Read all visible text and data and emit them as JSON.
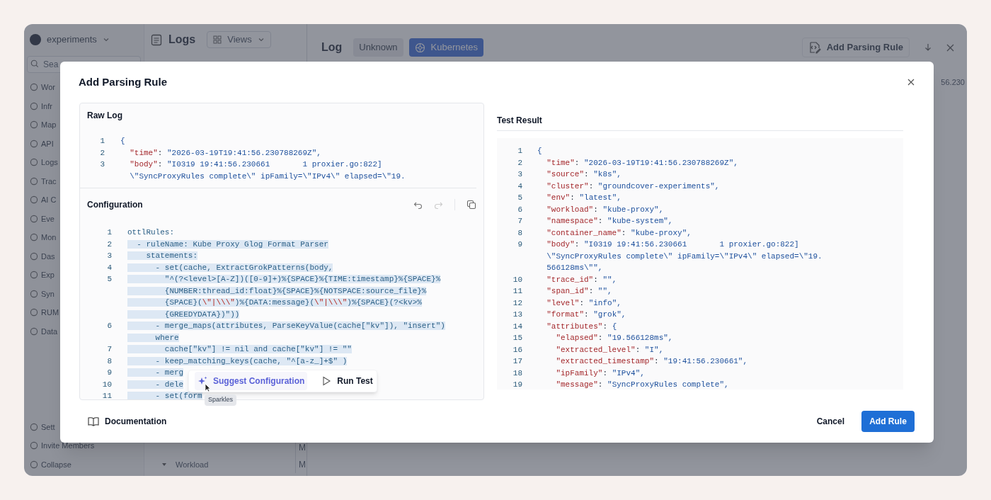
{
  "app": {
    "workspace": "experiments",
    "search_placeholder": "Sea",
    "nav": [
      {
        "label": "Wor"
      },
      {
        "label": "Infr"
      },
      {
        "label": "Map"
      },
      {
        "label": "API"
      },
      {
        "label": "Logs"
      },
      {
        "label": "Trac"
      },
      {
        "label": "AI C"
      },
      {
        "label": "Eve"
      },
      {
        "label": "Mon"
      },
      {
        "label": "Das"
      },
      {
        "label": "Exp"
      },
      {
        "label": "Syn"
      },
      {
        "label": "RUM"
      },
      {
        "label": "Data"
      }
    ],
    "bottom_nav": [
      {
        "label": "Sett"
      },
      {
        "label": "Invite Members"
      },
      {
        "label": "Collapse"
      }
    ],
    "page_title": "Logs",
    "views_button": "Views",
    "tree_item": "Workload",
    "column_cells": [
      "M",
      "M"
    ],
    "log_panel": {
      "title": "Log",
      "tags": [
        {
          "label": "Unknown",
          "selected": false
        },
        {
          "label": "Kubernetes",
          "selected": true
        }
      ],
      "add_rule_button": "Add Parsing Rule",
      "timestamp": "56.230"
    }
  },
  "dialog": {
    "title": "Add Parsing Rule",
    "raw_log": {
      "title": "Raw Log",
      "lines": [
        {
          "number": "1",
          "rows": [
            "{"
          ]
        },
        {
          "number": "2",
          "rows": [
            "  \"time\": \"2026-03-19T19:41:56.230788269Z\","
          ]
        },
        {
          "number": "3",
          "rows": [
            "  \"body\": \"I0319 19:41:56.230661       1 proxier.go:822]",
            "  \\\"SyncProxyRules complete\\\" ipFamily=\\\"IPv4\\\" elapsed=\\\"19."
          ]
        }
      ]
    },
    "configuration": {
      "title": "Configuration",
      "lines": [
        {
          "number": "1",
          "selected": false,
          "rows": [
            "ottlRules:"
          ]
        },
        {
          "number": "2",
          "selected": true,
          "rows": [
            "  - ruleName: Kube Proxy Glog Format Parser"
          ]
        },
        {
          "number": "3",
          "selected": true,
          "rows": [
            "    statements:"
          ]
        },
        {
          "number": "4",
          "selected": true,
          "rows": [
            "      - set(cache, ExtractGrokPatterns(body,"
          ]
        },
        {
          "number": "5",
          "selected": true,
          "rows": [
            "        \"^(?<level>[A-Z])([0-9]+)%{SPACE}%{TIME:timestamp}%{SPACE}%",
            "        {NUMBER:thread_id:float}%{SPACE}%{NOTSPACE:source_file}%",
            "        {SPACE}(\\\"|\\\\\\\")%{DATA:message}(\\\"|\\\\\\\")%{SPACE}(?<kv>%",
            "        {GREEDYDATA})\"))"
          ]
        },
        {
          "number": "6",
          "selected": true,
          "rows": [
            "      - merge_maps(attributes, ParseKeyValue(cache[\"kv\"]), \"insert\")",
            "      where"
          ]
        },
        {
          "number": "7",
          "selected": true,
          "rows": [
            "        cache[\"kv\"] != nil and cache[\"kv\"] != \"\""
          ]
        },
        {
          "number": "8",
          "selected": true,
          "rows": [
            "      - keep_matching_keys(cache, \"^[a-z_]+$\" )"
          ]
        },
        {
          "number": "9",
          "selected": true,
          "rows": [
            "      - merg"
          ]
        },
        {
          "number": "10",
          "selected": true,
          "rows": [
            "      - dele"
          ]
        },
        {
          "number": "11",
          "selected": true,
          "rows": [
            "      - set(form"
          ]
        }
      ],
      "suggest_button": "Suggest Configuration",
      "run_button": "Run Test",
      "tooltip": "Sparkles"
    },
    "test_result": {
      "title": "Test Result",
      "lines": [
        {
          "number": "1",
          "rows": [
            "{"
          ]
        },
        {
          "number": "2",
          "rows": [
            "  \"time\": \"2026-03-19T19:41:56.230788269Z\","
          ]
        },
        {
          "number": "3",
          "rows": [
            "  \"source\": \"k8s\","
          ]
        },
        {
          "number": "4",
          "rows": [
            "  \"cluster\": \"groundcover-experiments\","
          ]
        },
        {
          "number": "5",
          "rows": [
            "  \"env\": \"latest\","
          ]
        },
        {
          "number": "6",
          "rows": [
            "  \"workload\": \"kube-proxy\","
          ]
        },
        {
          "number": "7",
          "rows": [
            "  \"namespace\": \"kube-system\","
          ]
        },
        {
          "number": "8",
          "rows": [
            "  \"container_name\": \"kube-proxy\","
          ]
        },
        {
          "number": "9",
          "rows": [
            "  \"body\": \"I0319 19:41:56.230661       1 proxier.go:822]",
            "  \\\"SyncProxyRules complete\\\" ipFamily=\\\"IPv4\\\" elapsed=\\\"19.",
            "  566128ms\\\"\","
          ]
        },
        {
          "number": "10",
          "rows": [
            "  \"trace_id\": \"\","
          ]
        },
        {
          "number": "11",
          "rows": [
            "  \"span_id\": \"\","
          ]
        },
        {
          "number": "12",
          "rows": [
            "  \"level\": \"info\","
          ]
        },
        {
          "number": "13",
          "rows": [
            "  \"format\": \"grok\","
          ]
        },
        {
          "number": "14",
          "rows": [
            "  \"attributes\": {"
          ]
        },
        {
          "number": "15",
          "rows": [
            "    \"elapsed\": \"19.566128ms\","
          ]
        },
        {
          "number": "16",
          "rows": [
            "    \"extracted_level\": \"I\","
          ]
        },
        {
          "number": "17",
          "rows": [
            "    \"extracted_timestamp\": \"19:41:56.230661\","
          ]
        },
        {
          "number": "18",
          "rows": [
            "    \"ipFamily\": \"IPv4\","
          ]
        },
        {
          "number": "19",
          "rows": [
            "    \"message\": \"SyncProxyRules complete\","
          ]
        }
      ]
    },
    "documentation_link": "Documentation",
    "cancel_button": "Cancel",
    "add_button": "Add Rule"
  }
}
